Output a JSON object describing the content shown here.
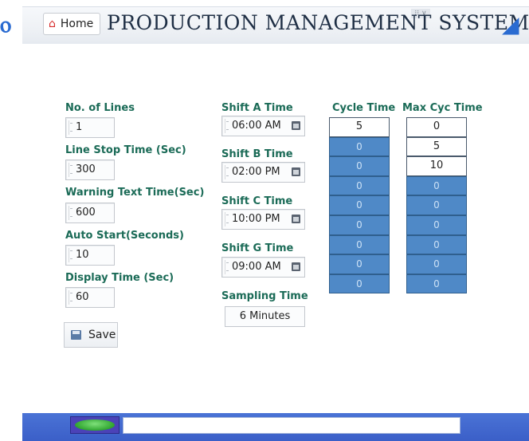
{
  "header": {
    "home_label": "Home",
    "title": "PRODUCTION MANAGEMENT SYSTEM",
    "tab_grip": "⁝⁝ ∨"
  },
  "fields": {
    "no_of_lines": {
      "label": "No. of Lines",
      "value": "1"
    },
    "line_stop_time": {
      "label": "Line Stop Time (Sec)",
      "value": "300"
    },
    "warning_text_time": {
      "label": "Warning Text Time(Sec)",
      "value": "600"
    },
    "auto_start": {
      "label": "Auto Start(Seconds)",
      "value": "10"
    },
    "display_time": {
      "label": "Display Time (Sec)",
      "value": "60"
    }
  },
  "shifts": {
    "a": {
      "label": "Shift A Time",
      "value": "06:00 AM"
    },
    "b": {
      "label": "Shift B Time",
      "value": "02:00 PM"
    },
    "c": {
      "label": "Shift C Time",
      "value": "10:00 PM"
    },
    "g": {
      "label": "Shift G Time",
      "value": "09:00 AM"
    }
  },
  "sampling": {
    "label": "Sampling Time",
    "value": "6 Minutes"
  },
  "cycle_time": {
    "header": "Cycle Time",
    "values": [
      "5",
      "0",
      "0",
      "0",
      "0",
      "0",
      "0",
      "0",
      "0"
    ]
  },
  "max_cyc_time": {
    "header": "Max Cyc Time",
    "values": [
      "0",
      "5",
      "10",
      "0",
      "0",
      "0",
      "0",
      "0",
      "0"
    ]
  },
  "save_label": "Save",
  "colors": {
    "label_green": "#1b6b57",
    "cell_blue": "#4f89c7",
    "bottom_bar": "#3b5fc8"
  }
}
